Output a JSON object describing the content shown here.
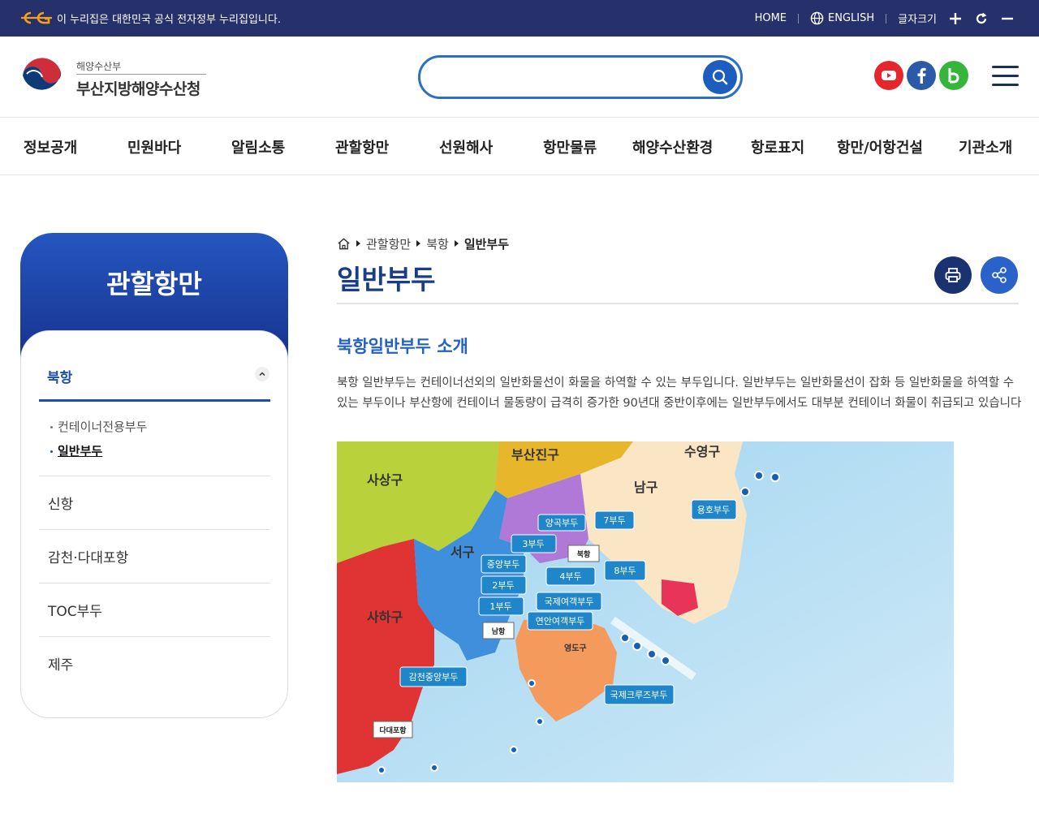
{
  "gov_banner": {
    "text": "이 누리집은 대한민국 공식 전자정부 누리집입니다."
  },
  "top_links": {
    "home": "HOME",
    "english": "ENGLISH",
    "font_size": "글자크기"
  },
  "header": {
    "org_parent": "해양수산부",
    "org_name": "부산지방해양수산청",
    "search_placeholder": ""
  },
  "social": [
    "youtube-icon",
    "facebook-icon",
    "blog-icon"
  ],
  "gnb": [
    "정보공개",
    "민원바다",
    "알림소통",
    "관할항만",
    "선원해사",
    "항만물류",
    "해양수산환경",
    "항로표지",
    "항만/어항건설",
    "기관소개"
  ],
  "sidebar": {
    "title": "관할항만",
    "active": "북항",
    "sub_items": [
      "컨테이너전용부두",
      "일반부두"
    ],
    "items": [
      "신항",
      "감천·다대포항",
      "TOC부두",
      "제주"
    ]
  },
  "breadcrumb": [
    "관할항만",
    "북항",
    "일반부두"
  ],
  "content": {
    "page_title": "일반부두",
    "section_title": "북항일반부두 소개",
    "intro": "북항 일반부두는 컨테이너선외의 일반화물선이 화물을 하역할 수 있는 부두입니다. 일반부두는 일반화물선이 잡화 등 일반화물을 하역할 수 있는 부두이나 부산항에 컨테이너 물동량이 급격히 증가한 90년대 중반이후에는 일반부두에서도 대부분 컨테이너 화물이 취급되고 있습니다"
  },
  "map": {
    "districts": [
      "부산진구",
      "수영구",
      "사상구",
      "남구",
      "서구",
      "사하구",
      "영도구"
    ],
    "piers": [
      "양곡부두",
      "7부두",
      "3부두",
      "중앙부두",
      "2부두",
      "1부두",
      "4부두",
      "8부두",
      "국제여객부두",
      "연안여객부두",
      "용호부두",
      "감천중앙부두",
      "국제크루즈부두"
    ],
    "port_labels": [
      "북항",
      "남항",
      "다대포항"
    ]
  },
  "colors": {
    "banner": "#26306b",
    "accent": "#1c4fa8",
    "title": "#1a3c8c"
  }
}
